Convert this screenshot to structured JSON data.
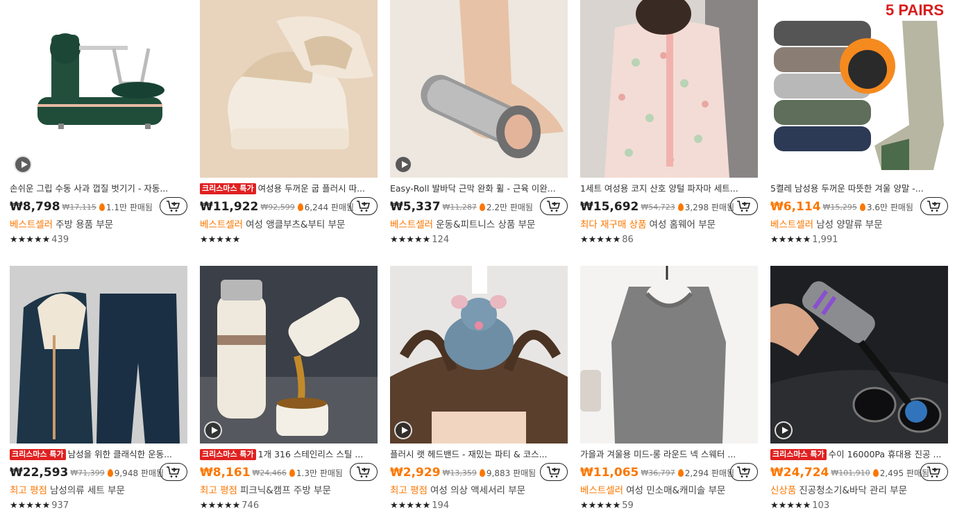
{
  "colors": {
    "accent": "#fb7701",
    "xmas_badge": "#e02020"
  },
  "products": [
    {
      "title": "손쉬운 그립 수동 사과 껍질 벗기기 - 자동...",
      "xmas": "",
      "price": "₩8,798",
      "orig": "₩17,115",
      "sold": "1.1만 판매됨",
      "badge": "베스트셀러",
      "category": "주방 용품 부문",
      "stars": "★★★★★",
      "reviews": "439",
      "video": true,
      "price_orange": false,
      "image": "apple-peeler"
    },
    {
      "title": "여성용 두꺼운 굽 플러시 따...",
      "xmas": "크리스마스 특가",
      "price": "₩11,922",
      "orig": "₩92,599",
      "sold": "6,244 판매됨",
      "badge": "베스트셀러",
      "category": "여성 앵클부츠&부티 부문",
      "stars": "★★★★★",
      "reviews": "",
      "video": false,
      "price_orange": false,
      "image": "plush-sneakers"
    },
    {
      "title": "Easy-Roll 발바닥 근막 완화 휠 - 근육 이완...",
      "xmas": "",
      "price": "₩5,337",
      "orig": "₩11,287",
      "sold": "2.2만 판매됨",
      "badge": "베스트셀러",
      "category": "운동&피트니스 상품 부문",
      "stars": "★★★★★",
      "reviews": "124",
      "video": true,
      "price_orange": false,
      "image": "foot-roller"
    },
    {
      "title": "1세트 여성용 코지 산호 양털 파자마 세트...",
      "xmas": "",
      "price": "₩15,692",
      "orig": "₩54,723",
      "sold": "3,298 판매됨",
      "badge": "최다 재구매 상품",
      "category": "여성 홈웨어 부문",
      "stars": "★★★★★",
      "reviews": "86",
      "video": false,
      "price_orange": false,
      "image": "pajamas"
    },
    {
      "title": "5켤레 남성용 두꺼운 따뜻한 겨울 양말 -...",
      "xmas": "",
      "price": "₩6,114",
      "orig": "₩15,295",
      "sold": "3.6만 판매됨",
      "badge": "베스트셀러",
      "category": "남성 양말류 부문",
      "stars": "★★★★★",
      "reviews": "1,991",
      "video": false,
      "price_orange": true,
      "image": "socks",
      "overlay": "5 PAIRS"
    },
    {
      "title": "남성을 위한 클래식한 운동...",
      "xmas": "크리스마스 특가",
      "price": "₩22,593",
      "orig": "₩71,399",
      "sold": "9,948 판매됨",
      "badge": "최고 평점",
      "category": "남성의류 세트 부문",
      "stars": "★★★★★",
      "reviews": "937",
      "video": false,
      "price_orange": false,
      "image": "tracksuit"
    },
    {
      "title": "1개 316 스테인리스 스틸 ...",
      "xmas": "크리스마스 특가",
      "price": "₩8,161",
      "orig": "₩24,466",
      "sold": "1.3만 판매됨",
      "badge": "최고 평점",
      "category": "피크닉&캠프 주방 부문",
      "stars": "★★★★★",
      "reviews": "746",
      "video": true,
      "price_orange": true,
      "image": "thermos"
    },
    {
      "title": "플러시 랫 헤드밴드 - 재밌는 파티 & 코스...",
      "xmas": "",
      "price": "₩2,929",
      "orig": "₩13,359",
      "sold": "9,883 판매됨",
      "badge": "최고 평점",
      "category": "여성 의상 액세서리 부문",
      "stars": "★★★★★",
      "reviews": "194",
      "video": true,
      "price_orange": true,
      "image": "rat-headband"
    },
    {
      "title": "가을과 겨울용 미드-롱 라운드 넥 스웨터 ...",
      "xmas": "",
      "price": "₩11,065",
      "orig": "₩36,797",
      "sold": "2,294 판매됨",
      "badge": "베스트셀러",
      "category": "여성 민소매&캐미솔 부문",
      "stars": "★★★★★",
      "reviews": "59",
      "video": false,
      "price_orange": true,
      "image": "sweater-vest"
    },
    {
      "title": "수이 16000Pa 휴대용 진공 ...",
      "xmas": "크리스마스 특가",
      "price": "₩24,724",
      "orig": "₩101,910",
      "sold": "2,495 판매됨",
      "badge": "신상품",
      "category": "진공청소기&바닥 관리 부문",
      "stars": "★★★★★",
      "reviews": "103",
      "video": true,
      "price_orange": true,
      "image": "car-vacuum"
    }
  ]
}
